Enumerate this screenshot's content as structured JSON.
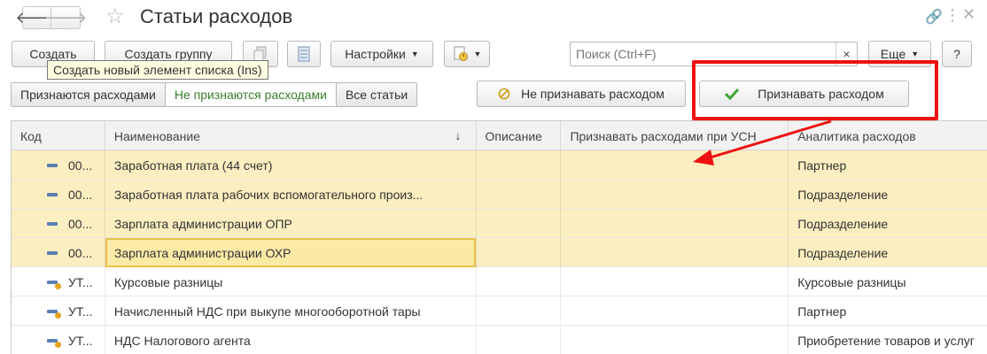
{
  "window": {
    "title": "Статьи расходов",
    "icons": [
      "back-arrow",
      "forward-arrow",
      "star-favorite",
      "link",
      "more-vertical",
      "close"
    ]
  },
  "toolbar": {
    "create_label": "Создать",
    "create_group_label": "Создать группу",
    "settings_label": "Настройки",
    "more_label": "Еще",
    "help_label": "?",
    "search_placeholder": "Поиск (Ctrl+F)",
    "search_clear": "×",
    "tooltip": "Создать новый элемент списка (Ins)"
  },
  "filters": {
    "items": [
      "Признаются расходами",
      "Не признаются расходами",
      "Все статьи"
    ],
    "active": "Не признаются расходами",
    "not_recognize_label": "Не признавать расходом",
    "recognize_label": "Признавать расходом"
  },
  "grid": {
    "columns": [
      "Код",
      "Наименование",
      "Описание",
      "Признавать расходами при УСН",
      "Аналитика расходов"
    ],
    "sort_icon": "↓",
    "rows": [
      {
        "code": "00...",
        "name": "Заработная плата (44 счет)",
        "desc": "",
        "usn": "",
        "analytics": "Партнер"
      },
      {
        "code": "00...",
        "name": "Заработная плата рабочих вспомогательного произ...",
        "desc": "",
        "usn": "",
        "analytics": "Подразделение"
      },
      {
        "code": "00...",
        "name": "Зарплата администрации ОПР",
        "desc": "",
        "usn": "",
        "analytics": "Подразделение"
      },
      {
        "code": "00...",
        "name": "Зарплата администрации ОХР",
        "desc": "",
        "usn": "",
        "analytics": "Подразделение"
      },
      {
        "code": "УТ...",
        "name": "Курсовые разницы",
        "desc": "",
        "usn": "",
        "analytics": "Курсовые разницы"
      },
      {
        "code": "УТ...",
        "name": "Начисленный НДС при выкупе многооборотной тары",
        "desc": "",
        "usn": "",
        "analytics": "Партнер"
      },
      {
        "code": "УТ...",
        "name": "НДС Налогового агента",
        "desc": "",
        "usn": "",
        "analytics": "Приобретение товаров и услуг"
      }
    ]
  },
  "colors": {
    "highlight_row": "#fbeec0",
    "annotation_red": "#ee1111",
    "active_filter_text": "#3a7e2b"
  }
}
